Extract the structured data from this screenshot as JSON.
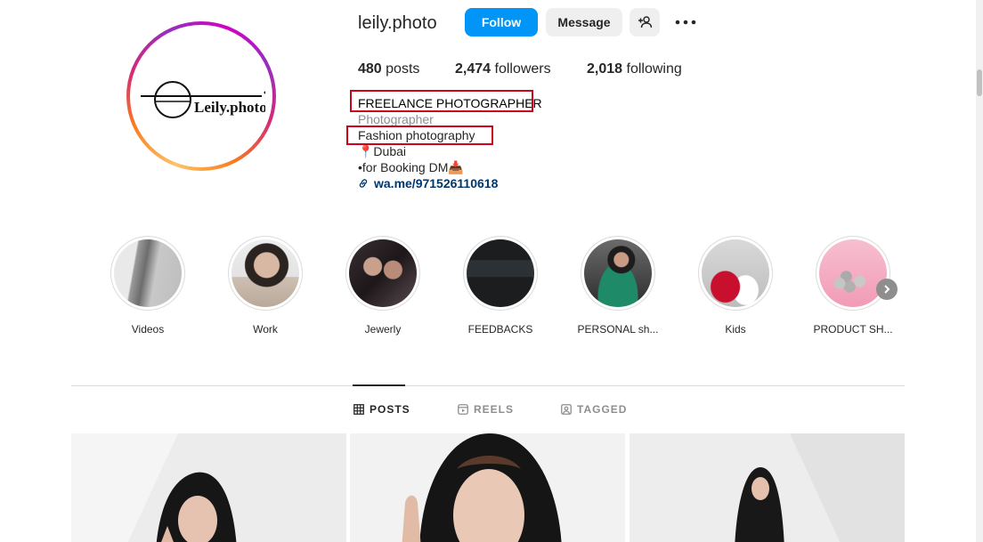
{
  "profile": {
    "username": "leily.photo",
    "logo_text": "Leily.photo",
    "follow_label": "Follow",
    "message_label": "Message"
  },
  "stats": {
    "posts_count": "480",
    "posts_label": "posts",
    "followers_count": "2,474",
    "followers_label": "followers",
    "following_count": "2,018",
    "following_label": "following"
  },
  "bio": {
    "title": "FREELANCE PHOTOGRAPHER",
    "category": "Photographer",
    "line1": "Fashion photography",
    "line2": "📍Dubai",
    "line3": "•for Booking DM📥",
    "link": "wa.me/971526110618"
  },
  "highlights": [
    {
      "label": "Videos"
    },
    {
      "label": "Work"
    },
    {
      "label": "Jewerly"
    },
    {
      "label": "FEEDBACKS"
    },
    {
      "label": "PERSONAL sh..."
    },
    {
      "label": "Kids"
    },
    {
      "label": "PRODUCT SH..."
    }
  ],
  "tabs": {
    "posts": "POSTS",
    "reels": "REELS",
    "tagged": "TAGGED"
  },
  "colors": {
    "follow_button": "#0095f6",
    "highlight_box": "#d0021b",
    "link": "#00376b"
  }
}
